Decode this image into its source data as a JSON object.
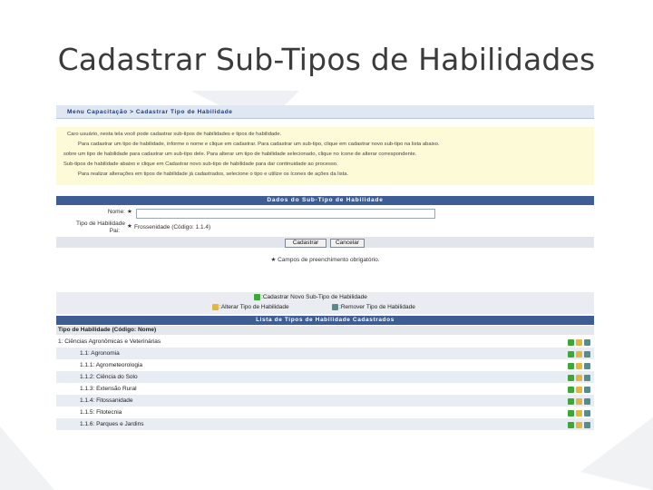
{
  "slide": {
    "title": "Cadastrar Sub-Tipos de Habilidades"
  },
  "breadcrumb": "Menu Capacitação > Cadastrar Tipo de Habilidade",
  "info_lines": [
    "Caro usuário, nesta tela você pode cadastrar sub-tipos de habilidades e tipos de habilidade.",
    "Para cadastrar um tipo de habilidade, informe o nome e clique em cadastrar. Para cadastrar um sub-tipo, clique em cadastrar novo sub-tipo na lista abaixo.",
    "sobre um tipo de habilidade para cadastrar um sub-tipo dele. Para alterar um tipo de habilidade selecionado, clique no ícone de alterar correspondente.",
    "Sub-tipos de habilidade abaixo e clique em Cadastrar novo sub-tipo de habilidade para dar continuidade ao processo.",
    "Para realizar alterações em tipos de habilidade já cadastrados, selecione o tipo e utilize os ícones de ações da lista."
  ],
  "form": {
    "section_title": "Dados do Sub-Tipo de Habilidade",
    "name_label": "Nome:",
    "name_value": "",
    "parent_label_line1": "Tipo de Habilidade",
    "parent_label_line2": "Pai:",
    "parent_value": "Frossenidade (Código: 1.1.4)",
    "required_mark": "★",
    "submit_label": "Cadastrar",
    "cancel_label": "Cancelar",
    "required_note": "★ Campos de preenchimento obrigatório."
  },
  "legend": {
    "add": "Cadastrar Novo Sub-Tipo de Habilidade",
    "edit": "Alterar Tipo de Habilidade",
    "remove": "Remover Tipo de Habilidade"
  },
  "list": {
    "title": "Lista de Tipos de Habilidade Cadastrados",
    "column_header": "Tipo de Habilidade (Código: Nome)",
    "rows": [
      {
        "code": "1",
        "name": "Ciências Agronômicas e Veterinárias",
        "level": 0
      },
      {
        "code": "1.1",
        "name": "Agronomia",
        "level": 1
      },
      {
        "code": "1.1.1",
        "name": "Agrometeorologia",
        "level": 2
      },
      {
        "code": "1.1.2",
        "name": "Ciência do Solo",
        "level": 2
      },
      {
        "code": "1.1.3",
        "name": "Extensão Rural",
        "level": 2
      },
      {
        "code": "1.1.4",
        "name": "Fitossanidade",
        "level": 2
      },
      {
        "code": "1.1.5",
        "name": "Fitotecnia",
        "level": 2
      },
      {
        "code": "1.1.6",
        "name": "Parques e Jardins",
        "level": 2
      }
    ]
  },
  "colors": {
    "header_blue": "#3e5d95",
    "info_yellow": "#fdfbd7",
    "row_alt": "#e8edf4"
  }
}
